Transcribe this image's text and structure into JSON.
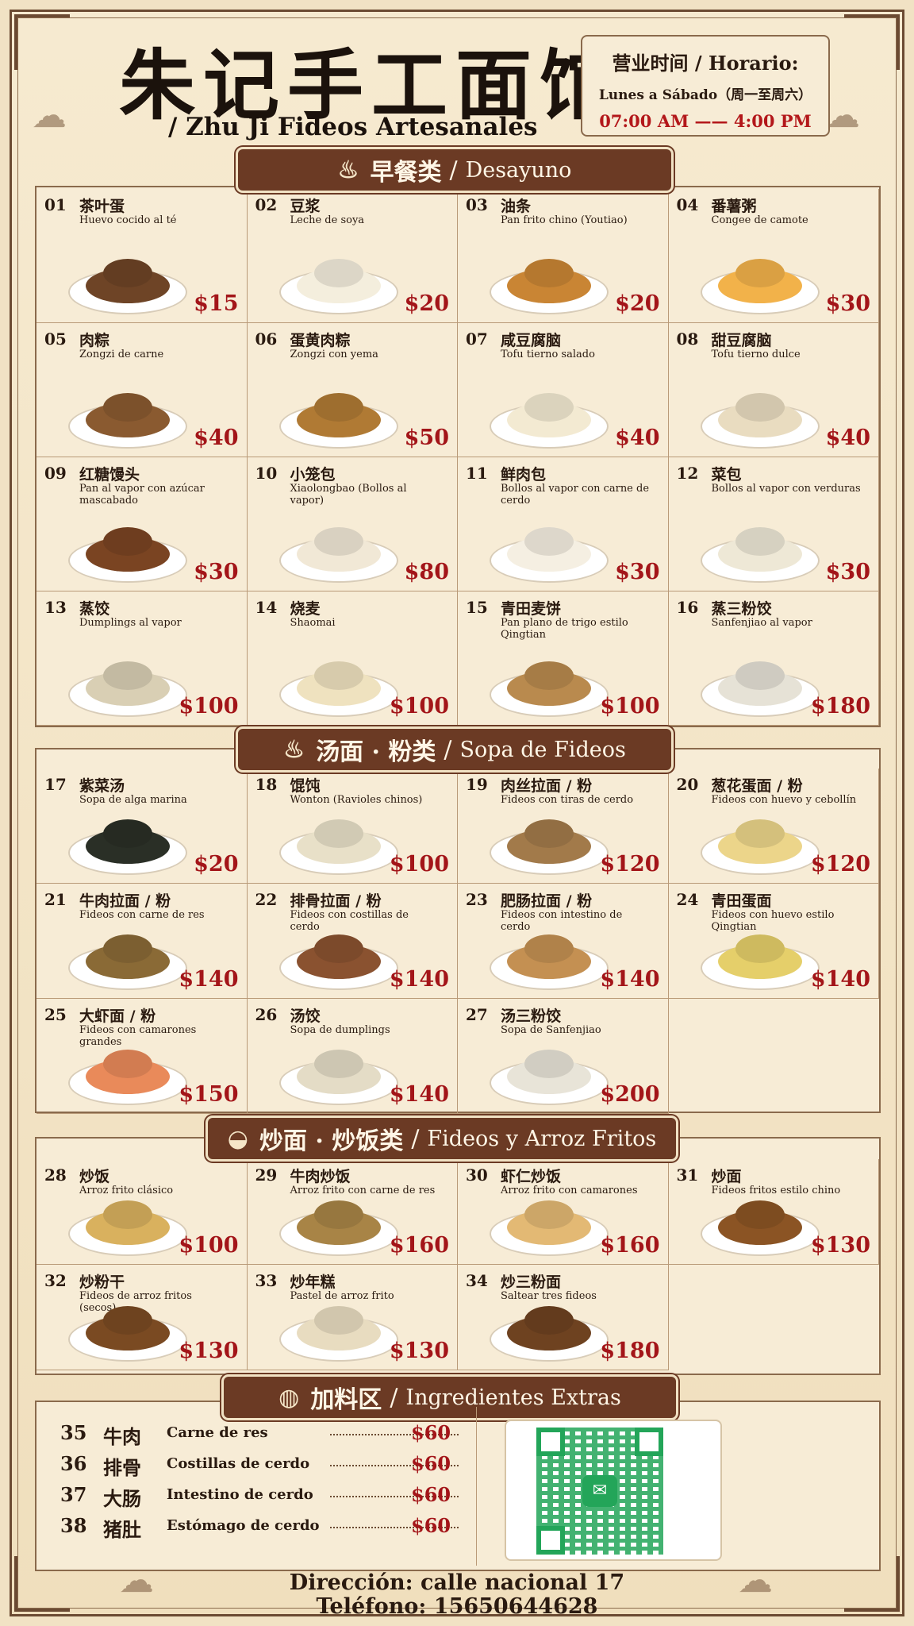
{
  "header": {
    "title_cn": "朱记手工面馆",
    "title_es": "/ Zhu Ji Fideos Artesanales",
    "hours_title": "营业时间 / Horario:",
    "hours_days": "Lunes a Sábado（周一至周六）",
    "hours_time": "07:00 AM —— 4:00 PM"
  },
  "sections": [
    {
      "cn": "早餐类",
      "sep": "/",
      "es": "Desayuno",
      "icon": "cake-icon",
      "items": [
        {
          "num": "01",
          "cn": "茶叶蛋",
          "es": "Huevo cocido al té",
          "price": "$15",
          "color": "#6e4426"
        },
        {
          "num": "02",
          "cn": "豆浆",
          "es": "Leche de soya",
          "price": "$20",
          "color": "#f4eedd"
        },
        {
          "num": "03",
          "cn": "油条",
          "es": "Pan frito chino (Youtiao)",
          "price": "$20",
          "color": "#c98534"
        },
        {
          "num": "04",
          "cn": "番薯粥",
          "es": "Congee de camote",
          "price": "$30",
          "color": "#f2b24a"
        },
        {
          "num": "05",
          "cn": "肉粽",
          "es": "Zongzi de carne",
          "price": "$40",
          "color": "#8a5a30"
        },
        {
          "num": "06",
          "cn": "蛋黄肉粽",
          "es": "Zongzi con yema",
          "price": "$50",
          "color": "#b07a34"
        },
        {
          "num": "07",
          "cn": "咸豆腐脑",
          "es": "Tofu tierno salado",
          "price": "$40",
          "color": "#f3ead2"
        },
        {
          "num": "08",
          "cn": "甜豆腐脑",
          "es": "Tofu tierno dulce",
          "price": "$40",
          "color": "#e9dcc0"
        },
        {
          "num": "09",
          "cn": "红糖馒头",
          "es": "Pan al vapor con azúcar mascabado",
          "price": "$30",
          "color": "#7a4422"
        },
        {
          "num": "10",
          "cn": "小笼包",
          "es": "Xiaolongbao (Bollos al vapor)",
          "price": "$80",
          "color": "#f1e8d6"
        },
        {
          "num": "11",
          "cn": "鲜肉包",
          "es": "Bollos al vapor con carne de cerdo",
          "price": "$30",
          "color": "#f5efe2"
        },
        {
          "num": "12",
          "cn": "菜包",
          "es": "Bollos al vapor con verduras",
          "price": "$30",
          "color": "#eee8d6"
        },
        {
          "num": "13",
          "cn": "蒸饺",
          "es": "Dumplings al vapor",
          "price": "$100",
          "color": "#d9cfb4"
        },
        {
          "num": "14",
          "cn": "烧麦",
          "es": "Shaomai",
          "price": "$100",
          "color": "#efe2bf"
        },
        {
          "num": "15",
          "cn": "青田麦饼",
          "es": "Pan plano de trigo estilo Qingtian",
          "price": "$100",
          "color": "#b98a4e"
        },
        {
          "num": "16",
          "cn": "蒸三粉饺",
          "es": "Sanfenjiao al vapor",
          "price": "$180",
          "color": "#e6e2d6"
        }
      ]
    },
    {
      "cn": "汤面 · 粉类",
      "sep": "/",
      "es": "Sopa de Fideos",
      "icon": "noodle-bowl-icon",
      "items": [
        {
          "num": "17",
          "cn": "紫菜汤",
          "es": "Sopa de alga marina",
          "price": "$20",
          "color": "#2a2f26"
        },
        {
          "num": "18",
          "cn": "馄饨",
          "es": "Wonton (Ravioles chinos)",
          "price": "$100",
          "color": "#e8e0c8"
        },
        {
          "num": "19",
          "cn": "肉丝拉面 / 粉",
          "es": "Fideos con tiras de cerdo",
          "price": "$120",
          "color": "#a27a4a"
        },
        {
          "num": "20",
          "cn": "葱花蛋面 / 粉",
          "es": "Fideos con huevo y cebollín",
          "price": "$120",
          "color": "#ecd58a"
        },
        {
          "num": "21",
          "cn": "牛肉拉面 / 粉",
          "es": "Fideos con carne de res",
          "price": "$140",
          "color": "#8a6a36"
        },
        {
          "num": "22",
          "cn": "排骨拉面 / 粉",
          "es": "Fideos con costillas de cerdo",
          "price": "$140",
          "color": "#8a5230"
        },
        {
          "num": "23",
          "cn": "肥肠拉面 / 粉",
          "es": "Fideos con intestino de cerdo",
          "price": "$140",
          "color": "#c49052"
        },
        {
          "num": "24",
          "cn": "青田蛋面",
          "es": "Fideos con huevo estilo Qingtian",
          "price": "$140",
          "color": "#e5cf6a"
        },
        {
          "num": "25",
          "cn": "大虾面 / 粉",
          "es": "Fideos con camarones grandes",
          "price": "$150",
          "color": "#e98a5a"
        },
        {
          "num": "26",
          "cn": "汤饺",
          "es": "Sopa de dumplings",
          "price": "$140",
          "color": "#e4dcc6"
        },
        {
          "num": "27",
          "cn": "汤三粉饺",
          "es": "Sopa de Sanfenjiao",
          "price": "$200",
          "color": "#e8e4d8"
        }
      ]
    },
    {
      "cn": "炒面 · 炒饭类",
      "sep": "/",
      "es": "Fideos y Arroz Fritos",
      "icon": "rice-bowl-icon",
      "items": [
        {
          "num": "28",
          "cn": "炒饭",
          "es": "Arroz frito clásico",
          "price": "$100",
          "color": "#d9b15e"
        },
        {
          "num": "29",
          "cn": "牛肉炒饭",
          "es": "Arroz frito con carne de res",
          "price": "$160",
          "color": "#a88446"
        },
        {
          "num": "30",
          "cn": "虾仁炒饭",
          "es": "Arroz frito con camarones",
          "price": "$160",
          "color": "#e3b974"
        },
        {
          "num": "31",
          "cn": "炒面",
          "es": "Fideos fritos estilo chino",
          "price": "$130",
          "color": "#8b5424"
        },
        {
          "num": "32",
          "cn": "炒粉干",
          "es": "Fideos de arroz fritos (secos)",
          "price": "$130",
          "color": "#7a4a22"
        },
        {
          "num": "33",
          "cn": "炒年糕",
          "es": "Pastel de arroz frito",
          "price": "$130",
          "color": "#e8dcc0"
        },
        {
          "num": "34",
          "cn": "炒三粉面",
          "es": "Saltear tres fideos",
          "price": "$180",
          "color": "#6e4220"
        }
      ]
    }
  ],
  "extras": {
    "cn": "加料区",
    "sep": "/",
    "es": "Ingredientes Extras",
    "icon": "bowl-icon",
    "items": [
      {
        "num": "35",
        "cn": "牛肉",
        "es": "Carne de res",
        "price": "$60"
      },
      {
        "num": "36",
        "cn": "排骨",
        "es": "Costillas de cerdo",
        "price": "$60"
      },
      {
        "num": "37",
        "cn": "大肠",
        "es": "Intestino de cerdo",
        "price": "$60"
      },
      {
        "num": "38",
        "cn": "猪肚",
        "es": "Estómago de cerdo",
        "price": "$60"
      }
    ]
  },
  "qr": {
    "icon": "wechat-icon",
    "color": "#23a559"
  },
  "footer": {
    "address": "Dirección: calle nacional 17",
    "phone": "Teléfono: 15650644628"
  },
  "colors": {
    "price": "#a31519",
    "banner": "#6b3a24",
    "border": "#8a6a4c",
    "background": "#f1e2c4"
  }
}
